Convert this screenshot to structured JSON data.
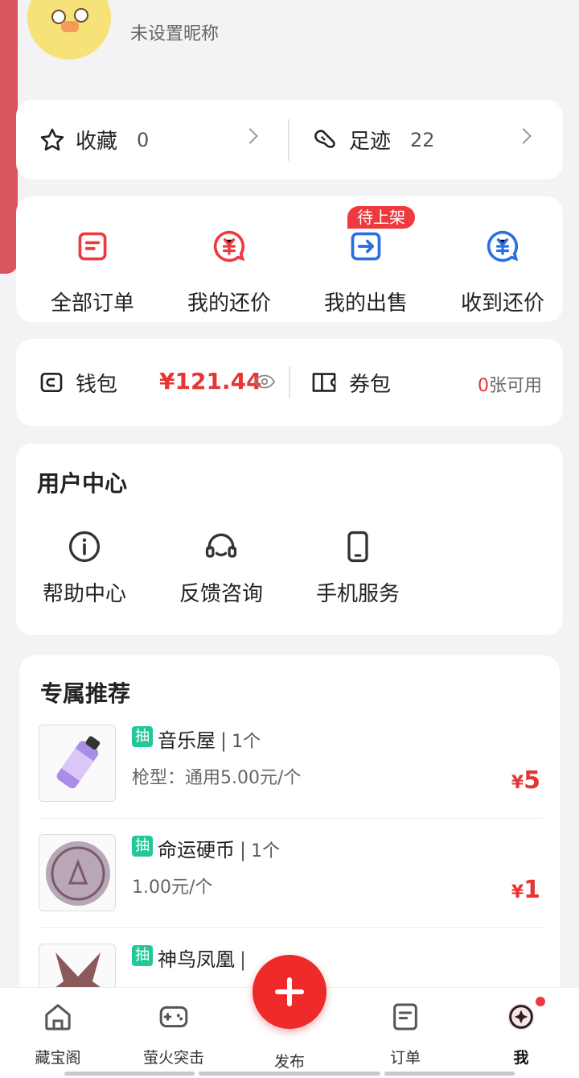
{
  "profile": {
    "nickname": "未设置昵称"
  },
  "favorites": {
    "collect_label": "收藏",
    "collect_count": "0",
    "history_label": "足迹",
    "history_count": "22"
  },
  "orders": {
    "items": [
      {
        "label": "全部订单",
        "icon": "order-list-icon"
      },
      {
        "label": "我的还价",
        "icon": "yuan-bubble-icon"
      },
      {
        "label": "我的出售",
        "icon": "sell-arrow-icon"
      },
      {
        "label": "收到还价",
        "icon": "yuan-bubble-icon"
      }
    ],
    "badge": "待上架"
  },
  "wallet": {
    "wallet_label": "钱包",
    "amount": "¥121.44",
    "coupon_label": "券包",
    "coupon_zero": "0",
    "coupon_suffix": "张可用"
  },
  "user_center": {
    "title": "用户中心",
    "items": [
      {
        "label": "帮助中心",
        "icon": "info-icon"
      },
      {
        "label": "反馈咨询",
        "icon": "headset-icon"
      },
      {
        "label": "手机服务",
        "icon": "phone-icon"
      }
    ]
  },
  "recommend": {
    "title": "专属推荐",
    "items": [
      {
        "tag": "抽",
        "name": "音乐屋",
        "sep": "|",
        "qty": "1个",
        "sub": "枪型：通用5.00元/个",
        "price_symbol": "¥",
        "price": "5"
      },
      {
        "tag": "抽",
        "name": "命运硬币",
        "sep": "|",
        "qty": "1个",
        "sub": "1.00元/个",
        "price_symbol": "¥",
        "price": "1"
      },
      {
        "tag": "抽",
        "name": "神鸟凤凰",
        "sep": "|",
        "qty": "",
        "sub": "",
        "price_symbol": "",
        "price": ""
      }
    ]
  },
  "tabbar": {
    "tabs": [
      {
        "label": "藏宝阁",
        "icon": "home-icon"
      },
      {
        "label": "萤火突击",
        "icon": "gamepad-icon"
      },
      {
        "label": "发布",
        "icon": "plus-icon"
      },
      {
        "label": "订单",
        "icon": "order-icon"
      },
      {
        "label": "我",
        "icon": "profile-icon"
      }
    ]
  },
  "colors": {
    "accent": "#ee3a3f",
    "price": "#e53535",
    "tag": "#22c89a",
    "blue": "#2a6fe0"
  }
}
